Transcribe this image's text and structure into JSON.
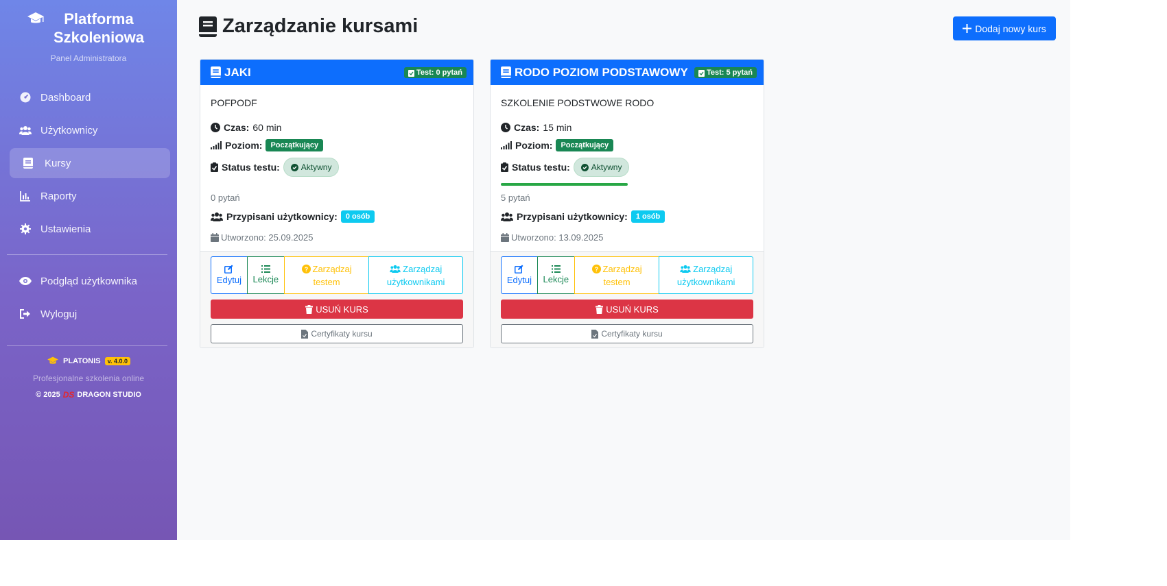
{
  "sidebar": {
    "title": "Platforma Szkoleniowa",
    "subtitle": "Panel Administratora",
    "nav": [
      {
        "label": "Dashboard",
        "icon": "gauge-icon"
      },
      {
        "label": "Użytkownicy",
        "icon": "users-icon"
      },
      {
        "label": "Kursy",
        "icon": "book-icon",
        "active": true
      },
      {
        "label": "Raporty",
        "icon": "chart-icon"
      },
      {
        "label": "Ustawienia",
        "icon": "gear-icon"
      }
    ],
    "nav2": [
      {
        "label": "Podgląd użytkownika",
        "icon": "eye-icon"
      },
      {
        "label": "Wyloguj",
        "icon": "logout-icon"
      }
    ],
    "footer": {
      "brand": "PLATONIS",
      "version": "v. 4.0.0",
      "tagline": "Profesjonalne szkolenia online",
      "copyright": "© 2025",
      "studio_logo": "DS",
      "studio": "DRAGON STUDIO"
    }
  },
  "main": {
    "title": "Zarządzanie kursami",
    "add_button": "Dodaj nowy kurs",
    "labels": {
      "time": "Czas:",
      "level": "Poziom:",
      "status": "Status testu:",
      "assigned": "Przypisani użytkownicy:",
      "edit": "Edytuj",
      "lessons": "Lekcje",
      "test_line1": "Zarządzaj",
      "test_line2": "testem",
      "users_line1": "Zarządzaj",
      "users_line2": "użytkownikami",
      "delete": "USUŃ KURS",
      "certs": "Certyfikaty kursu"
    },
    "courses": [
      {
        "title": "JAKI",
        "test_badge": "Test: 0 pytań",
        "description": "POFPODF",
        "time": "60 min",
        "level": "Początkujący",
        "status": "Aktywny",
        "questions": "0 pytań",
        "assigned": "0 osób",
        "created": "Utworzono: 25.09.2025",
        "progress": 0
      },
      {
        "title": "RODO POZIOM PODSTAWOWY",
        "test_badge": "Test: 5 pytań",
        "description": "SZKOLENIE PODSTWOWE RODO",
        "time": "15 min",
        "level": "Początkujący",
        "status": "Aktywny",
        "questions": "5 pytań",
        "assigned": "1 osób",
        "created": "Utworzono: 13.09.2025",
        "progress": 1
      }
    ]
  },
  "colors": {
    "primary": "#0d6efd",
    "success": "#198754",
    "danger": "#dc3545",
    "warning": "#ffc107",
    "info": "#0dcaf0"
  }
}
